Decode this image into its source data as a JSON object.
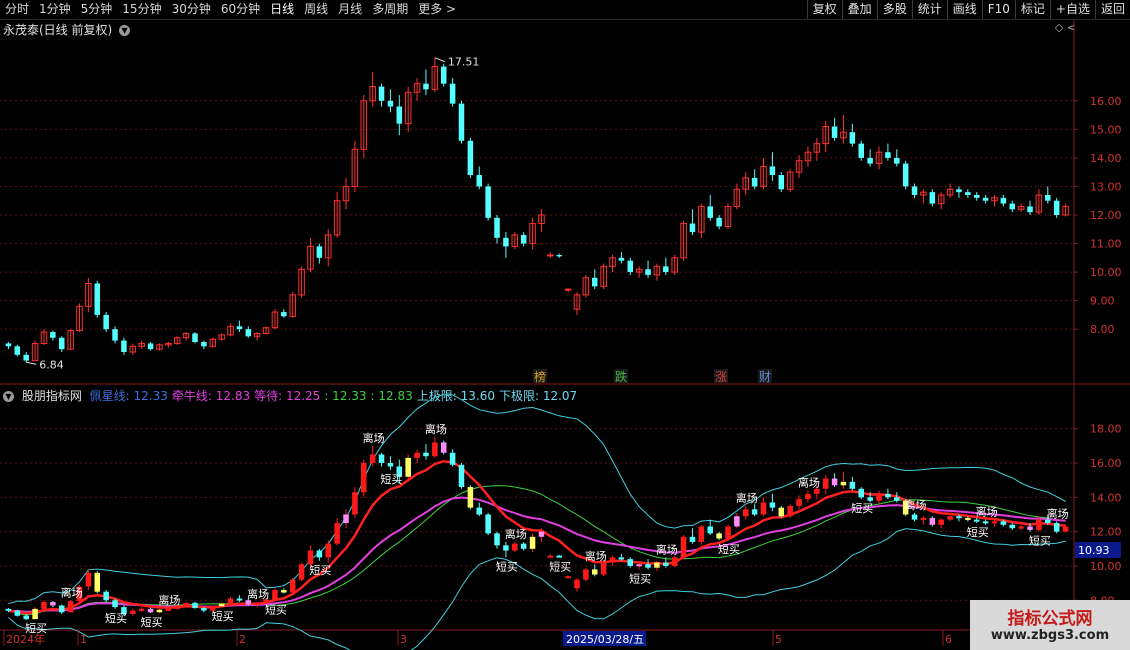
{
  "toolbar": {
    "periods": [
      "分时",
      "1分钟",
      "5分钟",
      "15分钟",
      "30分钟",
      "60分钟",
      "日线",
      "周线",
      "月线",
      "多周期",
      "更多 >"
    ],
    "active_period": "日线",
    "tools": [
      "复权",
      "叠加",
      "多股",
      "统计",
      "画线",
      "F10",
      "标记",
      "+自选",
      "返回"
    ]
  },
  "stock": {
    "title": "永茂泰(日线 前复权)",
    "info_icon": "chevron-down-icon",
    "high_label": "17.51",
    "low_label": "6.84"
  },
  "price_axis": [
    "16.00",
    "15.00",
    "14.00",
    "13.00",
    "12.00",
    "11.00",
    "10.00",
    "9.00",
    "8.00"
  ],
  "event_markers": [
    {
      "label": "榜",
      "color": "#d9a020"
    },
    {
      "label": "跌",
      "color": "#3fb83f"
    },
    {
      "label": "涨",
      "color": "#d04040"
    },
    {
      "label": "财",
      "color": "#5c8fd6"
    }
  ],
  "indicator": {
    "name": "股朋指标网",
    "fields": [
      {
        "label": "佩星线: 12.33",
        "color": "#3c6fe0"
      },
      {
        "label": "牵牛线: 12.83",
        "color": "#e040e0"
      },
      {
        "label": "等待: 12.25",
        "color": "#e040e0"
      },
      {
        "label": ": 12.33",
        "color": "#3fcf3f"
      },
      {
        "label": ": 12.83",
        "color": "#3fcf3f"
      },
      {
        "label": "上极限: 13.60",
        "color": "#6fd8f0"
      },
      {
        "label": "下极限: 12.07",
        "color": "#6fd8f0"
      }
    ],
    "axis": [
      "18.00",
      "16.00",
      "14.00",
      "12.00",
      "10.00",
      "8.00"
    ],
    "current_value": "10.93",
    "signal_labels": [
      "离场",
      "短买"
    ]
  },
  "date_axis": {
    "labels": [
      "2024年",
      "1",
      "2",
      "3",
      "5",
      "6"
    ],
    "cursor_date": "2025/03/28/五"
  },
  "watermark": {
    "line1": "指标公式网",
    "line2": "www.zbgs3.com"
  },
  "colors": {
    "up": "#ff3232",
    "down": "#54ffff",
    "ma_red": "#ff2020",
    "ma_magenta": "#e040e0",
    "band": "#40d0e0",
    "thin_green": "#40d040"
  },
  "chart_data": {
    "type": "candlestick",
    "ylim": [
      6.5,
      18.2
    ],
    "ohlc": [
      [
        7.5,
        7.55,
        7.3,
        7.4
      ],
      [
        7.4,
        7.45,
        7.05,
        7.1
      ],
      [
        7.1,
        7.2,
        6.84,
        6.9
      ],
      [
        6.9,
        7.6,
        6.9,
        7.5
      ],
      [
        7.5,
        8.0,
        7.45,
        7.9
      ],
      [
        7.9,
        7.95,
        7.6,
        7.7
      ],
      [
        7.7,
        7.75,
        7.2,
        7.3
      ],
      [
        7.3,
        8.0,
        7.3,
        7.95
      ],
      [
        7.95,
        8.9,
        7.9,
        8.8
      ],
      [
        8.8,
        9.8,
        8.6,
        9.6
      ],
      [
        9.6,
        9.7,
        8.4,
        8.5
      ],
      [
        8.5,
        8.6,
        7.9,
        8.0
      ],
      [
        8.0,
        8.1,
        7.5,
        7.6
      ],
      [
        7.6,
        7.7,
        7.1,
        7.2
      ],
      [
        7.2,
        7.5,
        7.1,
        7.4
      ],
      [
        7.4,
        7.6,
        7.3,
        7.5
      ],
      [
        7.5,
        7.55,
        7.25,
        7.3
      ],
      [
        7.3,
        7.5,
        7.25,
        7.45
      ],
      [
        7.45,
        7.55,
        7.35,
        7.5
      ],
      [
        7.5,
        7.75,
        7.45,
        7.7
      ],
      [
        7.7,
        7.9,
        7.6,
        7.85
      ],
      [
        7.85,
        7.9,
        7.5,
        7.55
      ],
      [
        7.55,
        7.6,
        7.3,
        7.4
      ],
      [
        7.4,
        7.7,
        7.35,
        7.65
      ],
      [
        7.65,
        7.85,
        7.6,
        7.8
      ],
      [
        7.8,
        8.2,
        7.75,
        8.1
      ],
      [
        8.1,
        8.3,
        7.9,
        8.0
      ],
      [
        8.0,
        8.1,
        7.7,
        7.75
      ],
      [
        7.75,
        7.9,
        7.6,
        7.85
      ],
      [
        7.85,
        8.1,
        7.8,
        8.05
      ],
      [
        8.05,
        8.7,
        8.0,
        8.6
      ],
      [
        8.6,
        8.7,
        8.4,
        8.45
      ],
      [
        8.45,
        9.3,
        8.4,
        9.2
      ],
      [
        9.2,
        10.2,
        9.1,
        10.1
      ],
      [
        10.1,
        11.2,
        10.0,
        10.9
      ],
      [
        10.9,
        11.0,
        10.3,
        10.5
      ],
      [
        10.5,
        11.5,
        10.2,
        11.3
      ],
      [
        11.3,
        12.8,
        11.2,
        12.5
      ],
      [
        12.5,
        13.3,
        12.2,
        13.0
      ],
      [
        13.0,
        14.6,
        12.8,
        14.3
      ],
      [
        14.3,
        16.2,
        14.0,
        16.0
      ],
      [
        16.0,
        17.0,
        15.8,
        16.5
      ],
      [
        16.5,
        16.6,
        15.8,
        16.0
      ],
      [
        16.0,
        16.4,
        15.6,
        15.8
      ],
      [
        15.8,
        16.2,
        14.8,
        15.2
      ],
      [
        15.2,
        16.5,
        14.9,
        16.3
      ],
      [
        16.3,
        16.8,
        16.0,
        16.6
      ],
      [
        16.6,
        17.1,
        16.2,
        16.4
      ],
      [
        16.4,
        17.51,
        16.3,
        17.2
      ],
      [
        17.2,
        17.3,
        16.5,
        16.6
      ],
      [
        16.6,
        16.8,
        15.8,
        15.9
      ],
      [
        15.9,
        16.0,
        14.5,
        14.6
      ],
      [
        14.6,
        14.7,
        13.3,
        13.4
      ],
      [
        13.4,
        13.7,
        12.9,
        13.0
      ],
      [
        13.0,
        13.1,
        11.8,
        11.9
      ],
      [
        11.9,
        12.0,
        11.0,
        11.2
      ],
      [
        11.2,
        11.4,
        10.5,
        10.9
      ],
      [
        10.9,
        11.4,
        10.8,
        11.3
      ],
      [
        11.3,
        11.4,
        10.9,
        11.0
      ],
      [
        11.0,
        11.9,
        10.8,
        11.7
      ],
      [
        11.7,
        12.2,
        11.4,
        12.0
      ],
      [
        10.6,
        10.7,
        10.5,
        10.6
      ],
      [
        10.6,
        10.65,
        10.5,
        10.55
      ],
      [
        9.4,
        9.45,
        9.3,
        9.4
      ],
      [
        8.7,
        9.3,
        8.5,
        9.2
      ],
      [
        9.2,
        9.9,
        9.1,
        9.8
      ],
      [
        9.8,
        10.1,
        9.4,
        9.5
      ],
      [
        9.5,
        10.3,
        9.4,
        10.2
      ],
      [
        10.2,
        10.6,
        10.0,
        10.5
      ],
      [
        10.5,
        10.7,
        10.3,
        10.4
      ],
      [
        10.4,
        10.5,
        9.9,
        10.0
      ],
      [
        10.0,
        10.2,
        9.8,
        10.1
      ],
      [
        10.1,
        10.4,
        9.8,
        9.9
      ],
      [
        9.9,
        10.3,
        9.7,
        10.2
      ],
      [
        10.2,
        10.5,
        9.9,
        10.0
      ],
      [
        10.0,
        10.6,
        9.9,
        10.5
      ],
      [
        10.5,
        11.8,
        10.4,
        11.7
      ],
      [
        11.7,
        12.2,
        11.3,
        11.4
      ],
      [
        11.4,
        12.4,
        11.2,
        12.3
      ],
      [
        12.3,
        12.7,
        11.8,
        11.9
      ],
      [
        11.9,
        12.0,
        11.5,
        11.6
      ],
      [
        11.6,
        12.4,
        11.5,
        12.3
      ],
      [
        12.3,
        13.1,
        12.2,
        12.9
      ],
      [
        12.9,
        13.5,
        12.7,
        13.3
      ],
      [
        13.3,
        13.6,
        12.9,
        13.0
      ],
      [
        13.0,
        14.0,
        12.9,
        13.7
      ],
      [
        13.7,
        14.2,
        13.2,
        13.4
      ],
      [
        13.4,
        13.5,
        12.8,
        12.9
      ],
      [
        12.9,
        13.6,
        12.8,
        13.5
      ],
      [
        13.5,
        14.1,
        13.3,
        13.9
      ],
      [
        13.9,
        14.4,
        13.7,
        14.2
      ],
      [
        14.2,
        14.7,
        13.9,
        14.5
      ],
      [
        14.5,
        15.3,
        14.2,
        15.1
      ],
      [
        15.1,
        15.4,
        14.6,
        14.7
      ],
      [
        14.7,
        15.5,
        14.5,
        14.9
      ],
      [
        14.9,
        15.2,
        14.4,
        14.5
      ],
      [
        14.5,
        14.6,
        13.9,
        14.0
      ],
      [
        14.0,
        14.3,
        13.7,
        13.8
      ],
      [
        13.8,
        14.4,
        13.6,
        14.2
      ],
      [
        14.2,
        14.5,
        13.9,
        14.0
      ],
      [
        14.0,
        14.3,
        13.7,
        13.8
      ],
      [
        13.8,
        13.9,
        12.9,
        13.0
      ],
      [
        13.0,
        13.1,
        12.6,
        12.7
      ],
      [
        12.7,
        12.9,
        12.4,
        12.8
      ],
      [
        12.8,
        12.9,
        12.3,
        12.4
      ],
      [
        12.4,
        12.8,
        12.2,
        12.7
      ],
      [
        12.7,
        13.1,
        12.6,
        12.9
      ],
      [
        12.9,
        13.0,
        12.6,
        12.8
      ],
      [
        12.8,
        12.9,
        12.6,
        12.7
      ],
      [
        12.7,
        12.8,
        12.5,
        12.6
      ],
      [
        12.6,
        12.7,
        12.4,
        12.5
      ],
      [
        12.5,
        12.7,
        12.3,
        12.6
      ],
      [
        12.6,
        12.7,
        12.3,
        12.4
      ],
      [
        12.4,
        12.5,
        12.1,
        12.2
      ],
      [
        12.2,
        12.4,
        12.1,
        12.3
      ],
      [
        12.3,
        12.5,
        12.0,
        12.1
      ],
      [
        12.1,
        12.9,
        12.0,
        12.7
      ],
      [
        12.7,
        13.0,
        12.4,
        12.5
      ],
      [
        12.5,
        12.6,
        11.9,
        12.0
      ],
      [
        12.0,
        12.4,
        11.95,
        12.3
      ]
    ]
  }
}
